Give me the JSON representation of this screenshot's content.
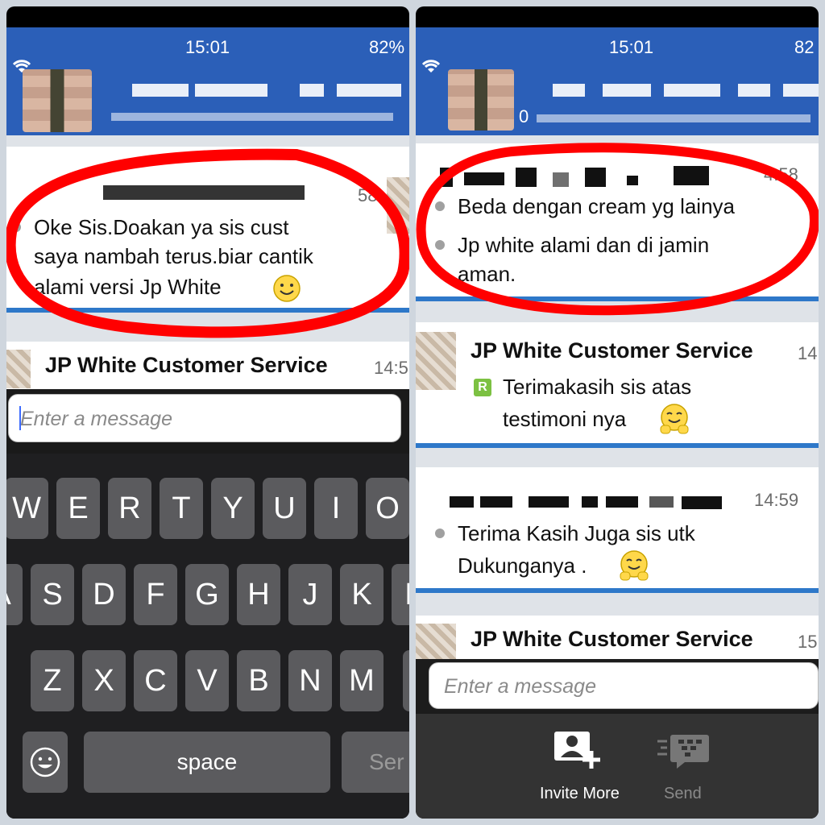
{
  "left": {
    "status": {
      "time": "15:01",
      "battery": "82%"
    },
    "message_time": "58",
    "message_lines": [
      "Oke Sis.Doakan ya sis cust",
      "saya nambah terus.biar cantik",
      "alami versi Jp White"
    ],
    "next_sender": "JP White Customer Service",
    "next_time": "14:5",
    "input_placeholder": "Enter a message",
    "keyboard": {
      "row1": [
        "W",
        "E",
        "R",
        "T",
        "Y",
        "U",
        "I",
        "O"
      ],
      "row2": [
        "A",
        "S",
        "D",
        "F",
        "G",
        "H",
        "J",
        "K",
        "L"
      ],
      "row3": [
        "Z",
        "X",
        "C",
        "V",
        "B",
        "N",
        "M"
      ],
      "space": "space",
      "send": "Ser"
    }
  },
  "right": {
    "status": {
      "time": "15:01",
      "battery": "82"
    },
    "header_count": "0",
    "msg1_time": "4:58",
    "msg1_lines": [
      "Beda dengan cream yg lainya",
      "Jp white alami dan di jamin",
      "aman."
    ],
    "cs_sender": "JP White Customer Service",
    "cs_time": "14",
    "cs_badge": "R",
    "cs_lines": [
      "Terimakasih sis atas",
      "testimoni nya"
    ],
    "msg3_time": "14:59",
    "msg3_lines": [
      "Terima Kasih Juga sis utk",
      "Dukunganya ."
    ],
    "cs_sender2": "JP White Customer Service",
    "cs_time2": "15",
    "input_placeholder": "Enter a message",
    "invite_label": "Invite More",
    "send_label": "Send"
  },
  "colors": {
    "header": "#2b5fb8",
    "accent": "#2e78c9",
    "annotation": "#ff0000"
  }
}
